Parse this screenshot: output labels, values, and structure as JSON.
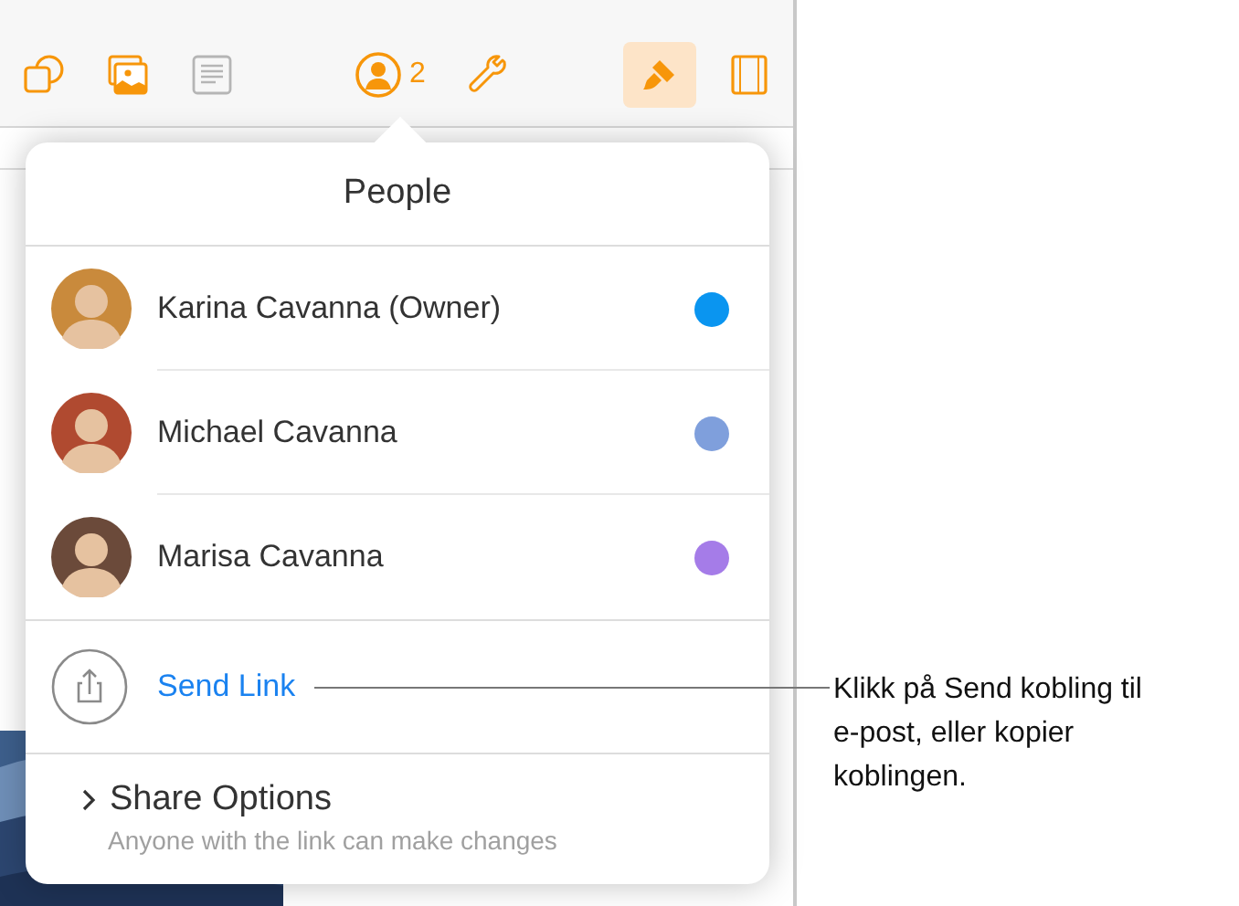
{
  "toolbar": {
    "buttons": [
      {
        "kind": "shapes",
        "selected": false,
        "disabled": false
      },
      {
        "kind": "media",
        "selected": false,
        "disabled": false
      },
      {
        "kind": "comment",
        "selected": false,
        "disabled": true
      },
      {
        "kind": "collaborate",
        "selected": false,
        "disabled": false,
        "count": "2"
      },
      {
        "kind": "tools",
        "selected": false,
        "disabled": false
      },
      {
        "kind": "format",
        "selected": true,
        "disabled": false
      },
      {
        "kind": "document",
        "selected": false,
        "disabled": false
      }
    ]
  },
  "popover": {
    "title": "People",
    "people": [
      {
        "name": "Karina Cavanna (Owner)",
        "color": "#0a95f0"
      },
      {
        "name": "Michael Cavanna",
        "color": "#7f9fdc"
      },
      {
        "name": "Marisa Cavanna",
        "color": "#a57ce8"
      }
    ],
    "send_link": "Send Link",
    "share_options": {
      "title": "Share Options",
      "subtitle": "Anyone with the link can make changes"
    }
  },
  "callout": "Klikk på Send kobling til e-post, eller kopier koblingen."
}
